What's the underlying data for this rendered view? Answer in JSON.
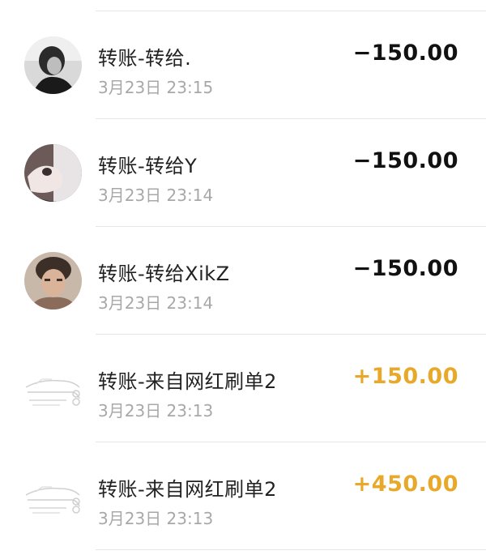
{
  "transactions": [
    {
      "title": "转账-转给.",
      "time": "3月23日 23:15",
      "amount": "−150.00",
      "direction": "out",
      "avatar": "user-photo-bw-girl"
    },
    {
      "title": "转账-转给Y",
      "time": "3月23日 23:14",
      "amount": "−150.00",
      "direction": "out",
      "avatar": "user-photo-hand"
    },
    {
      "title": "转账-转给XikZ",
      "time": "3月23日 23:14",
      "amount": "−150.00",
      "direction": "out",
      "avatar": "user-photo-boy"
    },
    {
      "title": "转账-来自网红刷单2",
      "time": "3月23日 23:13",
      "amount": "+150.00",
      "direction": "in",
      "avatar": "sketch-car-image"
    },
    {
      "title": "转账-来自网红刷单2",
      "time": "3月23日 23:13",
      "amount": "+450.00",
      "direction": "in",
      "avatar": "sketch-car-image"
    }
  ],
  "colors": {
    "expense": "#111111",
    "income": "#e8a82a",
    "secondary_text": "#a8a8a8",
    "divider": "#e6e6e6"
  }
}
